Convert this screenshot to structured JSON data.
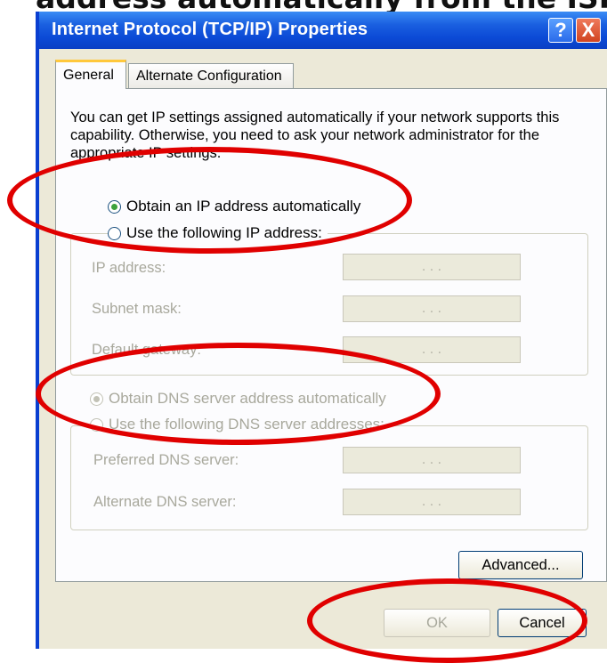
{
  "bleed_text": "address automatically from the ISP",
  "window": {
    "title": "Internet Protocol (TCP/IP) Properties",
    "help_button": "?",
    "close_button": "X"
  },
  "tabs": [
    {
      "label": "General",
      "active": true
    },
    {
      "label": "Alternate Configuration",
      "active": false
    }
  ],
  "description": "You can get IP settings assigned automatically if your network supports this capability. Otherwise, you need to ask your network administrator for the appropriate IP settings.",
  "ip_section": {
    "auto_option": {
      "label": "Obtain an IP address automatically",
      "selected": true
    },
    "manual_option": {
      "label": "Use the following IP address:",
      "selected": false
    },
    "fields": [
      {
        "label": "IP address:",
        "value": ". . ."
      },
      {
        "label": "Subnet mask:",
        "value": ". . ."
      },
      {
        "label": "Default gateway:",
        "value": ". . ."
      }
    ]
  },
  "dns_section": {
    "auto_option": {
      "label": "Obtain DNS server address automatically",
      "selected": true
    },
    "manual_option": {
      "label": "Use the following DNS server addresses:",
      "selected": false
    },
    "fields": [
      {
        "label": "Preferred DNS server:",
        "value": ". . ."
      },
      {
        "label": "Alternate DNS server:",
        "value": ". . ."
      }
    ]
  },
  "buttons": {
    "advanced": "Advanced...",
    "ok": "OK",
    "cancel": "Cancel"
  },
  "colors": {
    "annotation": "#e00000",
    "titlebar": "#0b4ad6",
    "dialog_bg": "#ece9d8"
  }
}
